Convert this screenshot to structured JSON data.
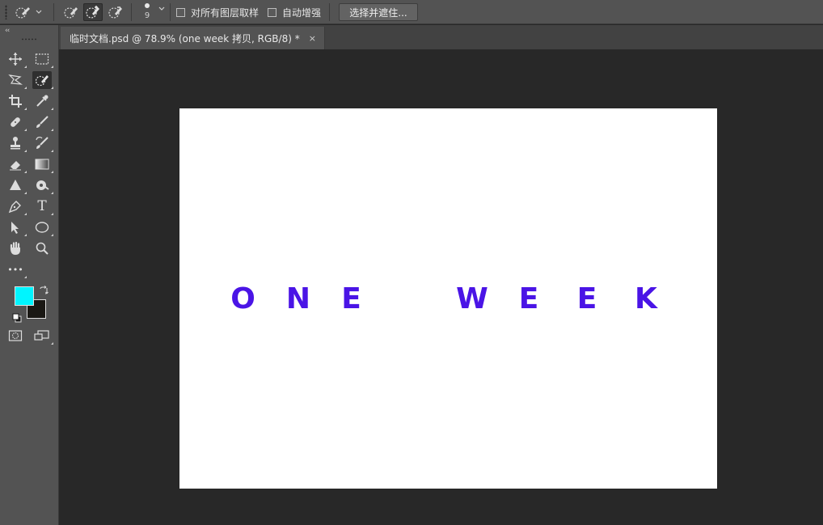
{
  "options_bar": {
    "tool_preset_icon": "quick-selection-icon",
    "mode_buttons": [
      {
        "icon": "new-selection-brush-icon",
        "active": false
      },
      {
        "icon": "add-to-selection-brush-icon",
        "active": true
      },
      {
        "icon": "subtract-from-selection-brush-icon",
        "active": false
      }
    ],
    "brush_size": "9",
    "sample_all_layers_label": "对所有图层取样",
    "sample_all_layers_checked": false,
    "auto_enhance_label": "自动增强",
    "auto_enhance_checked": false,
    "select_and_mask_label": "选择并遮住..."
  },
  "tools_panel": {
    "collapse_glyph": "‹‹",
    "tools": [
      "move-icon",
      "rectangular-marquee-icon",
      "polygonal-lasso-icon",
      "quick-selection-icon",
      "crop-icon",
      "eyedropper-icon",
      "spot-healing-brush-icon",
      "brush-icon",
      "clone-stamp-icon",
      "history-brush-icon",
      "eraser-icon",
      "gradient-icon",
      "blur-icon",
      "dodge-icon",
      "pen-icon",
      "type-icon",
      "path-selection-icon",
      "ellipse-icon",
      "hand-icon",
      "zoom-icon",
      "more-tools-icon"
    ],
    "active_tool": "quick-selection-icon",
    "type_tool_glyph": "T",
    "more_tools_glyph": "•••",
    "foreground_color": "#00f5ff",
    "background_color": "#1a1814"
  },
  "document": {
    "tab_title": "临时文档.psd @ 78.9% (one week 拷贝, RGB/8) *",
    "close_glyph": "×",
    "canvas_text_left": [
      "O",
      "N",
      "E"
    ],
    "canvas_text_right": [
      "W",
      "E",
      "E",
      "K"
    ],
    "canvas_text_color": "#4a14e6"
  }
}
